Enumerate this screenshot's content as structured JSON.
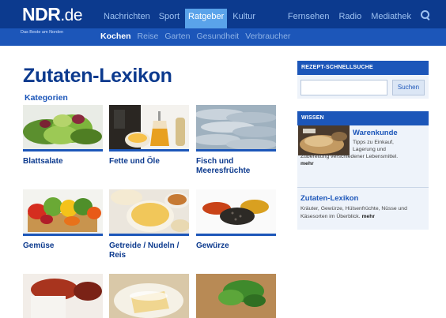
{
  "header": {
    "logo": {
      "main": "NDR",
      "suffix": ".de",
      "tagline": "Das Beste am Norden"
    },
    "top_nav": [
      "Nachrichten",
      "Sport",
      "Ratgeber",
      "Kultur"
    ],
    "top_nav_active": "Ratgeber",
    "right_nav": [
      "Fernsehen",
      "Radio",
      "Mediathek"
    ],
    "sub_nav": [
      "Kochen",
      "Reise",
      "Garten",
      "Gesundheit",
      "Verbraucher"
    ],
    "sub_nav_active": "Kochen"
  },
  "main": {
    "title": "Zutaten-Lexikon",
    "section_label": "Kategorien",
    "categories": [
      {
        "label": "Blattsalate",
        "icon": "lettuce-image"
      },
      {
        "label": "Fette und Öle",
        "icon": "oil-bottles-image"
      },
      {
        "label": "Fisch und Meeresfrüchte",
        "icon": "fish-image"
      },
      {
        "label": "Gemüse",
        "icon": "vegetables-image"
      },
      {
        "label": "Getreide / Nudeln / Reis",
        "icon": "pasta-image"
      },
      {
        "label": "Gewürze",
        "icon": "spices-image"
      },
      {
        "label": "",
        "icon": "paste-bowl-image"
      },
      {
        "label": "",
        "icon": "cheese-image"
      },
      {
        "label": "",
        "icon": "herbs-image"
      }
    ]
  },
  "sidebar": {
    "quicksearch": {
      "heading": "REZEPT-SCHNELLSUCHE",
      "input_value": "",
      "button": "Suchen"
    },
    "wissen": {
      "heading": "WISSEN",
      "warenkunde": {
        "title": "Warenkunde",
        "text_line1": "Tipps zu Einkauf,",
        "text_line2": "Lagerung und",
        "text_line3": "Zubereitung verschiedener Lebensmittel.",
        "more": "mehr"
      },
      "zutaten": {
        "title": "Zutaten-Lexikon",
        "text": "Kräuter, Gewürze, Hülsenfrüchte, Nüsse und Käsesorten im Überblick.",
        "more": "mehr"
      }
    }
  },
  "colors": {
    "topbar": "#0c3a8e",
    "subbar": "#1c56b9",
    "active_tab": "#5aa3ea",
    "sidebar_bg": "#eef3fa"
  }
}
